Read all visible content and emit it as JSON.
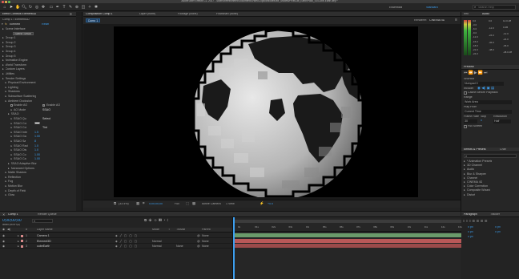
{
  "app": {
    "title": "Adobe After Effects CC 2017 - /Users/brentsmeier/Documents/VideoCopilot/Models/Mr_Models/PixelLab_Earth/Pack_v1/Cube-Earth.aep *"
  },
  "toolbar": {
    "workspaces": [
      "Essentials",
      "Standard"
    ],
    "active_workspace": "Standard",
    "search_placeholder": "Search Help"
  },
  "effect_controls": {
    "tab": "Effect Controls Element3D",
    "breadcrumb": "Comp 1 • Element3D",
    "effect_name": "Element",
    "reset": "Reset",
    "tree": [
      {
        "label": "Scene Interface",
        "indent": 1
      },
      {
        "label": "Scene Setup",
        "indent": 3,
        "button": true
      },
      {
        "label": "Group 1",
        "indent": 1
      },
      {
        "label": "Group 2",
        "indent": 1
      },
      {
        "label": "Group 3",
        "indent": 1
      },
      {
        "label": "Group 4",
        "indent": 1
      },
      {
        "label": "Group 5",
        "indent": 1
      },
      {
        "label": "Animation Engine",
        "indent": 1
      },
      {
        "label": "World Transform",
        "indent": 1
      },
      {
        "label": "Custom Layers",
        "indent": 1
      },
      {
        "label": "Utilities",
        "indent": 1
      },
      {
        "label": "Render Settings",
        "indent": 1
      },
      {
        "label": "Physical Environment",
        "indent": 2
      },
      {
        "label": "Lighting",
        "indent": 2
      },
      {
        "label": "Shadows",
        "indent": 2
      },
      {
        "label": "Subsurface Scattering",
        "indent": 2
      },
      {
        "label": "Ambient Occlusion",
        "indent": 2
      },
      {
        "label": "Enable AO",
        "indent": 4,
        "check1": true,
        "right": "Enable AO",
        "check2": true
      },
      {
        "label": "AO Mode",
        "indent": 4,
        "right": "SSAO",
        "rightval": true
      },
      {
        "label": "SSAO",
        "indent": 3
      },
      {
        "label": "SSAO Qu",
        "indent": 4,
        "right": "Select",
        "rightval": true
      },
      {
        "label": "SSAO Col",
        "indent": 4,
        "swatch": "#ffffff"
      },
      {
        "label": "SSAO Col",
        "indent": 4,
        "right": "Tint",
        "rightval": true
      },
      {
        "label": "SSAO Inte",
        "indent": 4,
        "num": "1.5"
      },
      {
        "label": "SSAO Ga",
        "indent": 4,
        "num": "1.00"
      },
      {
        "label": "SSAO Sa",
        "indent": 4,
        "num": "8"
      },
      {
        "label": "SSAO Rad",
        "indent": 4,
        "num": "1.0"
      },
      {
        "label": "SSAO Dis",
        "indent": 4,
        "num": "1.0"
      },
      {
        "label": "SSAO Co",
        "indent": 4,
        "num": "1.00"
      },
      {
        "label": "SSAO Ca",
        "indent": 4,
        "num": "1.00"
      },
      {
        "label": "SSAO Adaptive Blur",
        "indent": 3
      },
      {
        "label": "Advanced Options",
        "indent": 3
      },
      {
        "label": "Matte Shadow",
        "indent": 2
      },
      {
        "label": "Reflection",
        "indent": 2
      },
      {
        "label": "Fog",
        "indent": 2
      },
      {
        "label": "Motion Blur",
        "indent": 2
      },
      {
        "label": "Depth of Field",
        "indent": 2
      },
      {
        "label": "Glow",
        "indent": 2
      }
    ]
  },
  "composition": {
    "tab": "Composition Comp 1",
    "other_tabs": [
      "Layer (none)",
      "Footage (none)",
      "Flowchart (none)"
    ],
    "comp_label": "Comp 1",
    "renderer_label": "Renderer:",
    "renderer": "CINEMA 4D",
    "viewbar": {
      "zoom": "(33.4%)",
      "timecode": "0;00;00;00",
      "resolution": "Full",
      "camera": "Active Camera",
      "views": "1 View",
      "exposure": "+0.0"
    }
  },
  "info_panel": {
    "tabs": [
      "Info",
      "Audio"
    ],
    "db_left": [
      "0.0",
      "-3.0",
      "-6.0",
      "-9.0",
      "-12.0",
      "-15.0",
      "-18.0",
      "-21.0",
      "-24.0"
    ],
    "db_right": [
      "12.0 dB",
      "0 dB",
      "-12.0",
      "-24.0",
      "-36.0",
      "-48.0 dB"
    ],
    "db_mid": [
      "0.0",
      "-12.0",
      "-24.0",
      "-36.0",
      "-48.0"
    ]
  },
  "preview_panel": {
    "title": "Preview",
    "shortcut_label": "Shortcut",
    "shortcut": "Numpad 0",
    "include_label": "Include:",
    "cache_label": "Cache Before Playback",
    "range_label": "Range",
    "range": "Work Area",
    "playfrom_label": "Play From",
    "playfrom": "Current Time",
    "framerate_label": "Frame Rate",
    "skip_label": "Skip",
    "resolution_label": "Resolution",
    "framerate": "30",
    "skip": "0",
    "resolution": "Half",
    "fullscreen_label": "Full Screen"
  },
  "effects_panel": {
    "tabs": [
      "Effects & Presets",
      "Char"
    ],
    "items": [
      "* Animation Presets",
      "3D Channel",
      "Audio",
      "Blur & Sharpen",
      "Channel",
      "CINEMA 4D",
      "Color Correction",
      "Composite Wizard",
      "Distort"
    ]
  },
  "timeline": {
    "tabs": [
      "Comp 1",
      "Render Queue"
    ],
    "timecode": "0;00;00;00",
    "fps": "00000 (29.97 fps)",
    "columns": [
      "#",
      "Layer Name",
      "Mode",
      "T",
      "TrkMat",
      "Parent"
    ],
    "ruler": [
      "0s",
      "01s",
      "02s",
      "03s",
      "04s",
      "05s",
      "06s",
      "07s",
      "08s",
      "09s",
      "10s",
      "11s",
      "12s",
      "13s"
    ],
    "layers": [
      {
        "num": "1",
        "name": "Camera 1",
        "color": "#d88a8a",
        "mode": "",
        "trkmat": "",
        "parent": "None",
        "bar": "#6a9a6a"
      },
      {
        "num": "2",
        "name": "Element3D",
        "color": "#d88a8a",
        "mode": "Normal",
        "trkmat": "",
        "parent": "None",
        "bar": "#b85858"
      },
      {
        "num": "3",
        "name": "cubeEarth",
        "color": "#d88a8a",
        "mode": "Normal",
        "trkmat": "None",
        "parent": "None",
        "bar": "#9a4a4a"
      }
    ],
    "right_tabs": [
      "Paragraph",
      "Tracker"
    ],
    "paragraph": [
      "0 px",
      "0 px",
      "0 px",
      "0 px",
      "0 px"
    ]
  }
}
